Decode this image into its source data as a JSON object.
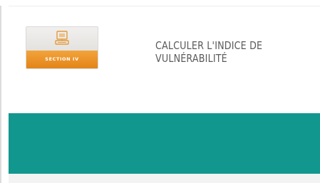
{
  "section_badge": {
    "label": "SECTION IV",
    "icon": "computer-icon"
  },
  "title": {
    "line1": "CALCULER L'INDICE DE",
    "line2": "VULNÉRABILITÉ"
  },
  "colors": {
    "accent_orange": "#e8901f",
    "teal_band": "#12978f",
    "title_text": "#5a5a5a"
  }
}
